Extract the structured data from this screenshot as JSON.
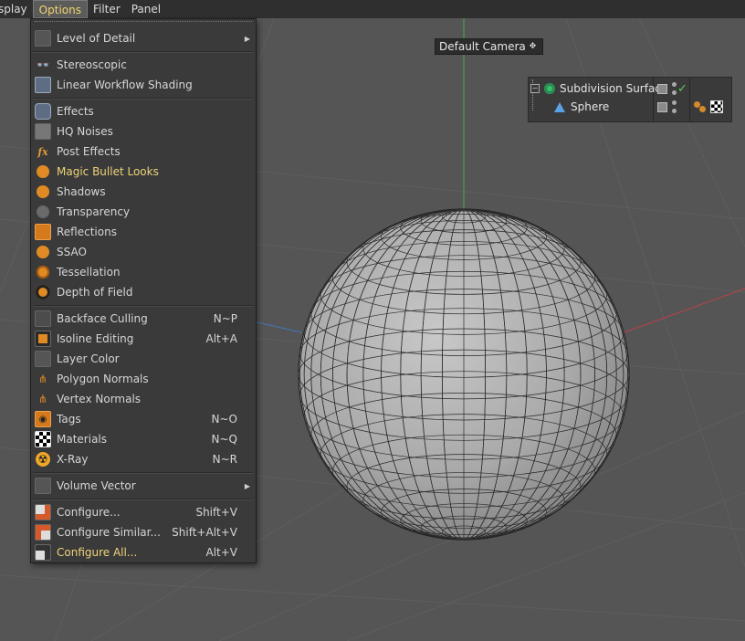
{
  "menubar": {
    "items": [
      {
        "label": "splay"
      },
      {
        "label": "Options"
      },
      {
        "label": "Filter"
      },
      {
        "label": "Panel"
      }
    ]
  },
  "viewport": {
    "camera_label": "Default Camera"
  },
  "object_manager": {
    "rows": [
      {
        "name": "Subdivision Surface"
      },
      {
        "name": "Sphere"
      }
    ]
  },
  "menu": {
    "items": [
      {
        "label": "Level of Detail",
        "shortcut": "",
        "icon": "blank-icon"
      },
      {
        "label": "Stereoscopic",
        "shortcut": "",
        "icon": "glasses-icon"
      },
      {
        "label": "Linear Workflow Shading",
        "shortcut": "",
        "icon": "gradient-icon"
      },
      {
        "label": "Effects",
        "shortcut": "",
        "icon": "effects-icon"
      },
      {
        "label": "HQ Noises",
        "shortcut": "",
        "icon": "noise-icon"
      },
      {
        "label": "Post Effects",
        "shortcut": "",
        "icon": "fx-icon"
      },
      {
        "label": "Magic Bullet Looks",
        "shortcut": "",
        "icon": "magic-bullet-icon"
      },
      {
        "label": "Shadows",
        "shortcut": "",
        "icon": "shadow-icon"
      },
      {
        "label": "Transparency",
        "shortcut": "",
        "icon": "transparency-icon"
      },
      {
        "label": "Reflections",
        "shortcut": "",
        "icon": "reflection-icon"
      },
      {
        "label": "SSAO",
        "shortcut": "",
        "icon": "ssao-icon"
      },
      {
        "label": "Tessellation",
        "shortcut": "",
        "icon": "tessellation-icon"
      },
      {
        "label": "Depth of Field",
        "shortcut": "",
        "icon": "depth-of-field-icon"
      },
      {
        "label": "Backface Culling",
        "shortcut": "N~P",
        "icon": "backface-icon"
      },
      {
        "label": "Isoline Editing",
        "shortcut": "Alt+A",
        "icon": "isoline-icon"
      },
      {
        "label": "Layer Color",
        "shortcut": "",
        "icon": "blank-icon"
      },
      {
        "label": "Polygon Normals",
        "shortcut": "",
        "icon": "polygon-normals-icon"
      },
      {
        "label": "Vertex Normals",
        "shortcut": "",
        "icon": "vertex-normals-icon"
      },
      {
        "label": "Tags",
        "shortcut": "N~O",
        "icon": "eye-icon"
      },
      {
        "label": "Materials",
        "shortcut": "N~Q",
        "icon": "checker-icon"
      },
      {
        "label": "X-Ray",
        "shortcut": "N~R",
        "icon": "radiation-icon"
      },
      {
        "label": "Volume Vector",
        "shortcut": "",
        "icon": "blank-icon"
      },
      {
        "label": "Configure...",
        "shortcut": "Shift+V",
        "icon": "configure-icon"
      },
      {
        "label": "Configure Similar...",
        "shortcut": "Shift+Alt+V",
        "icon": "configure-similar-icon"
      },
      {
        "label": "Configure All...",
        "shortcut": "Alt+V",
        "icon": "configure-all-icon"
      }
    ]
  }
}
